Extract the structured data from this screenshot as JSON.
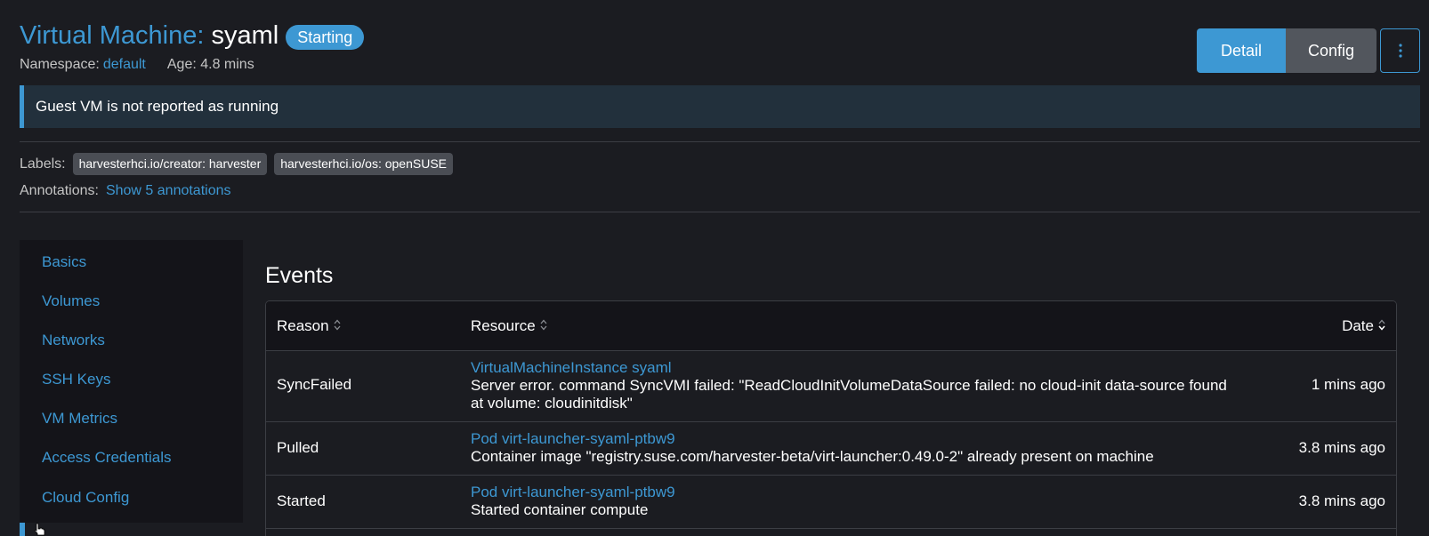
{
  "header": {
    "kind": "Virtual Machine:",
    "name": "syaml",
    "state": "Starting",
    "namespace_label": "Namespace:",
    "namespace": "default",
    "age": "Age: 4.8 mins"
  },
  "actions": {
    "detail": "Detail",
    "config": "Config",
    "more_icon": "vertical-dots-icon"
  },
  "banner": {
    "message": "Guest VM is not reported as running"
  },
  "labels": {
    "label": "Labels:",
    "items": [
      "harvesterhci.io/creator: harvester",
      "harvesterhci.io/os: openSUSE"
    ],
    "annotations_label": "Annotations:",
    "annotations_link": "Show 5 annotations"
  },
  "side_nav": {
    "items": [
      "Basics",
      "Volumes",
      "Networks",
      "SSH Keys",
      "VM Metrics",
      "Access Credentials",
      "Cloud Config"
    ]
  },
  "events": {
    "title": "Events",
    "columns": [
      "Reason",
      "Resource",
      "Date"
    ],
    "rows": [
      {
        "reason": "SyncFailed",
        "resource": "VirtualMachineInstance syaml",
        "message_line1": "Server error. command SyncVMI failed: \"ReadCloudInitVolumeDataSource failed: no cloud-init data-source found",
        "message_line2": "at volume: cloudinitdisk\"",
        "date": "1 mins ago"
      },
      {
        "reason": "Pulled",
        "resource": "Pod virt-launcher-syaml-ptbw9",
        "message_line1": "Container image \"registry.suse.com/harvester-beta/virt-launcher:0.49.0-2\" already present on machine",
        "date": "3.8 mins ago"
      },
      {
        "reason": "Started",
        "resource": "Pod virt-launcher-syaml-ptbw9",
        "message_line1": "Started container compute",
        "date": "3.8 mins ago"
      }
    ]
  },
  "colors": {
    "accent": "#3d98d3",
    "background": "#1b1c21",
    "panel": "#141419"
  }
}
